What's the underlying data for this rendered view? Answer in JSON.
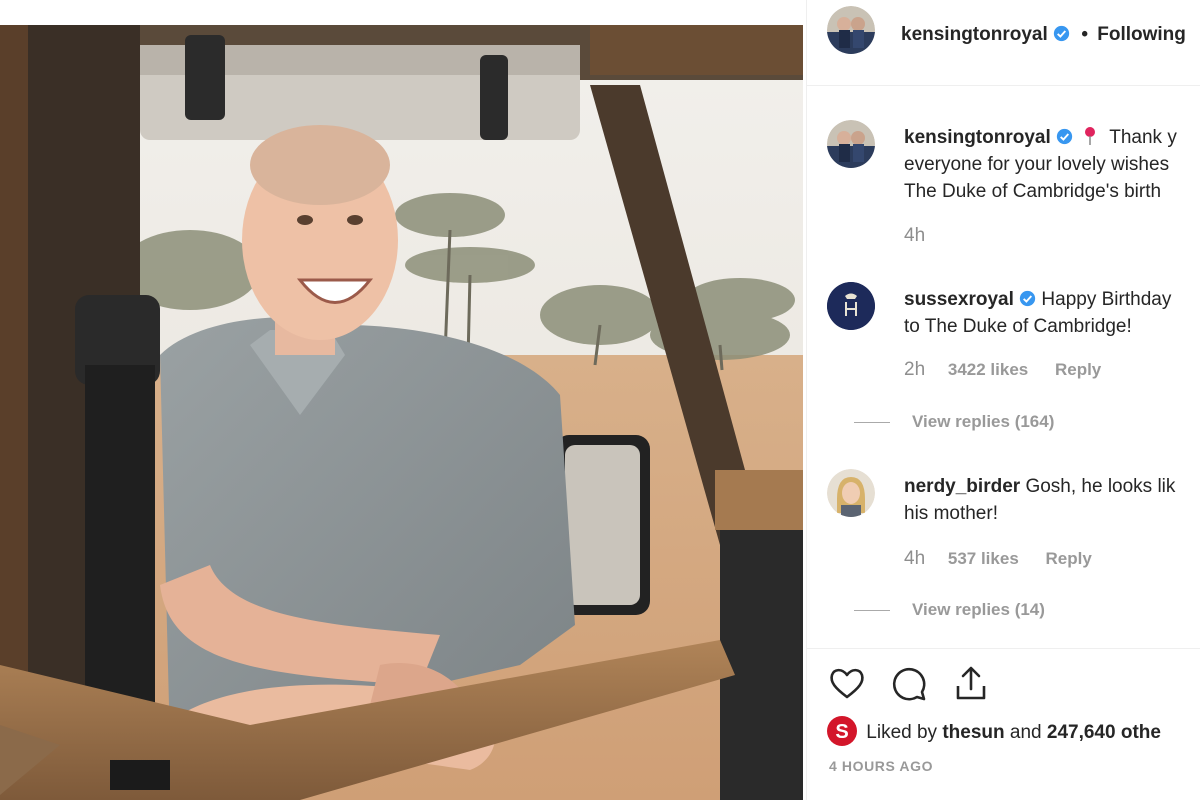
{
  "post": {
    "author": "kensingtonroyal",
    "follow_status": "Following",
    "dot": "•"
  },
  "comments": [
    {
      "username": "kensingtonroyal",
      "verified": true,
      "pin_icon": "round-pushpin-icon",
      "line1": "Thank y",
      "line2": "everyone for your lovely wishes",
      "line3": "The Duke of Cambridge's birth",
      "time": "4h"
    },
    {
      "username": "sussexroyal",
      "verified": true,
      "line1": "Happy Birthday",
      "line2": "to The Duke of Cambridge!",
      "time": "2h",
      "likes": "3422 likes",
      "reply": "Reply",
      "view_replies": "View replies (164)"
    },
    {
      "username": "nerdy_birder",
      "verified": false,
      "line1": "Gosh, he looks lik",
      "line2": "his mother!",
      "time": "4h",
      "likes": "537 likes",
      "reply": "Reply",
      "view_replies": "View replies (14)"
    }
  ],
  "likes_line": {
    "prefix": "Liked by ",
    "user": "thesun",
    "middle": " and ",
    "count": "247,640 othe"
  },
  "timestamp": "4 HOURS AGO",
  "icons": {
    "like": "heart-icon",
    "comment": "comment-bubble-icon",
    "share": "share-upload-icon",
    "verified": "verified-badge-icon"
  },
  "colors": {
    "verified_blue": "#3897f0",
    "text": "#262626",
    "muted": "#8e8e8e",
    "sussex_navy": "#1d2a5a",
    "sun_red": "#d3162a"
  }
}
